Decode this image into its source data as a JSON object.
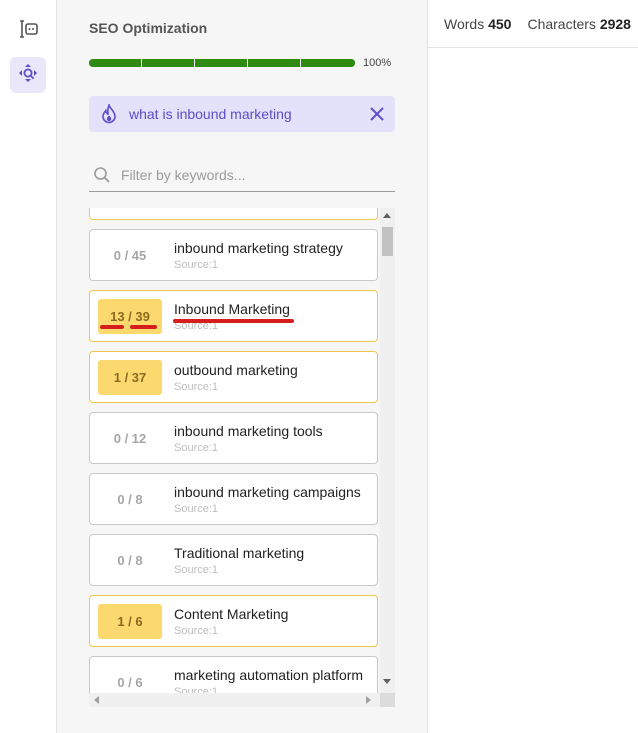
{
  "panel": {
    "title": "SEO Optimization"
  },
  "progress": {
    "value": 100,
    "label": "100%",
    "color": "#2f8a12",
    "segments": 5
  },
  "search_chip": {
    "keyword": "what is inbound marketing",
    "icon": "flame-icon",
    "close_icon": "close-icon"
  },
  "filter": {
    "placeholder": "Filter by keywords...",
    "value": ""
  },
  "keywords": [
    {
      "count": "0 / 45",
      "term": "inbound marketing strategy",
      "source": "Source:1",
      "active": false
    },
    {
      "count": "13 / 39",
      "term": "Inbound Marketing",
      "source": "Source:1",
      "active": true
    },
    {
      "count": "1 / 37",
      "term": "outbound marketing",
      "source": "Source:1",
      "active": true
    },
    {
      "count": "0 / 12",
      "term": "inbound marketing tools",
      "source": "Source:1",
      "active": false
    },
    {
      "count": "0 / 8",
      "term": "inbound marketing campaigns",
      "source": "Source:1",
      "active": false
    },
    {
      "count": "0 / 8",
      "term": "Traditional marketing",
      "source": "Source:1",
      "active": false
    },
    {
      "count": "1 / 6",
      "term": "Content Marketing",
      "source": "Source:1",
      "active": true
    },
    {
      "count": "0 / 6",
      "term": "marketing automation platform",
      "source": "Source:1",
      "active": false
    }
  ],
  "stats": {
    "words_label": "Words",
    "words_value": "450",
    "chars_label": "Characters",
    "chars_value": "2928"
  },
  "colors": {
    "accent": "#5b4ec9",
    "highlight": "#fcd96f",
    "annotation": "#d61e1e"
  }
}
